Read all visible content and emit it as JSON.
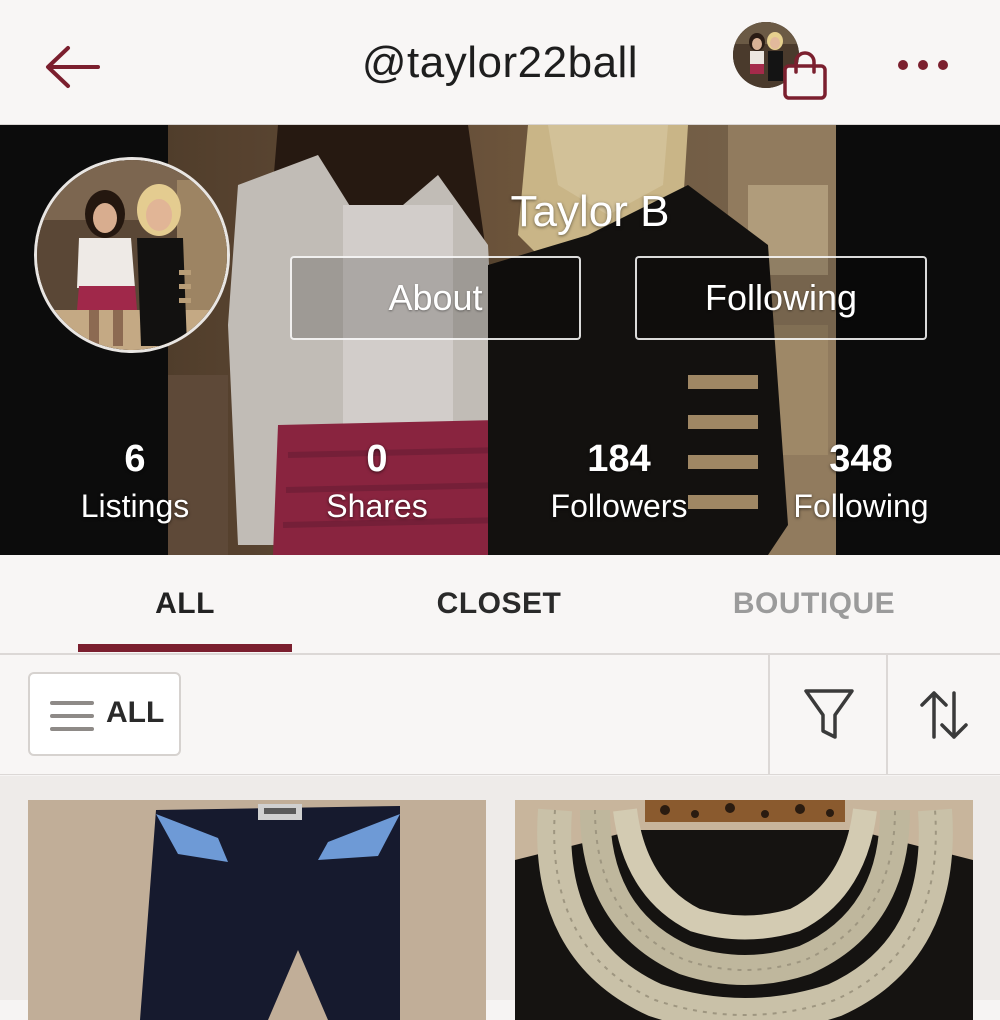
{
  "header": {
    "username": "@taylor22ball",
    "back_icon": "arrow-left-icon",
    "bundle_icon": "shopping-bag-icon",
    "more_icon": "more-horizontal-icon",
    "accent_color": "#7b1f2e"
  },
  "profile": {
    "display_name": "Taylor B",
    "about_label": "About",
    "following_button_label": "Following",
    "stats": [
      {
        "value": "6",
        "label": "Listings"
      },
      {
        "value": "0",
        "label": "Shares"
      },
      {
        "value": "184",
        "label": "Followers"
      },
      {
        "value": "348",
        "label": "Following"
      }
    ]
  },
  "tabs": [
    {
      "label": "ALL",
      "active": true
    },
    {
      "label": "CLOSET",
      "active": false
    },
    {
      "label": "BOUTIQUE",
      "active": false
    }
  ],
  "filter_bar": {
    "category_label": "ALL",
    "category_icon": "hamburger-menu-icon",
    "filter_icon": "filter-funnel-icon",
    "sort_icon": "sort-arrows-icon"
  },
  "listings": [
    {
      "image": "navy-leggings-with-blue-waistband-photo"
    },
    {
      "image": "gold-knit-infinity-scarf-on-bust-photo"
    }
  ]
}
